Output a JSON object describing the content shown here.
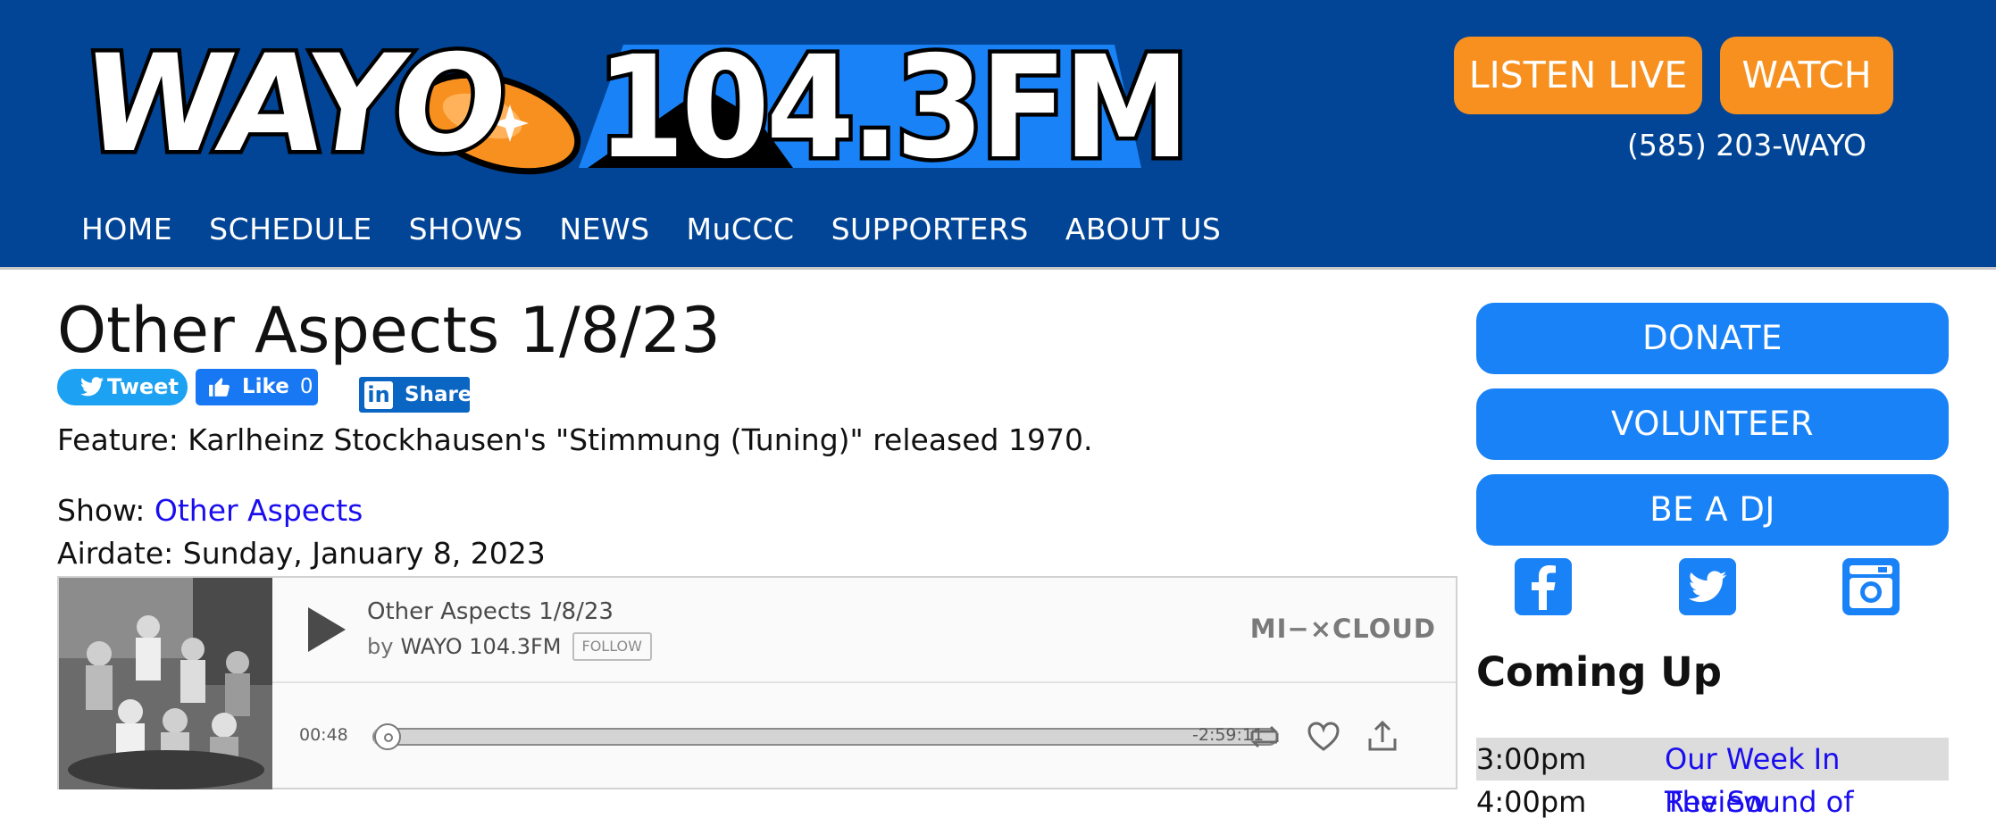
{
  "header": {
    "logo_text": "WAYO 104.3FM",
    "logo_wordmark": "WAYO",
    "logo_frequency": "104.3FM",
    "listen_live_label": "LISTEN LIVE",
    "watch_label": "WATCH",
    "phone": "(585) 203-WAYO",
    "nav": [
      "HOME",
      "SCHEDULE",
      "SHOWS",
      "NEWS",
      "MuCCC",
      "SUPPORTERS",
      "ABOUT US"
    ]
  },
  "post": {
    "title": "Other Aspects 1/8/23",
    "share": {
      "tweet_label": "Tweet",
      "like_label": "Like",
      "like_count": "0",
      "linkedin_label": "Share",
      "linkedin_icon_text": "in"
    },
    "feature": "Feature: Karlheinz Stockhausen's \"Stimmung (Tuning)\" released 1970.",
    "show_prefix": "Show: ",
    "show_name": "Other Aspects",
    "airdate": "Airdate: Sunday, January 8, 2023"
  },
  "player": {
    "track_title": "Other Aspects 1/8/23",
    "by_prefix": "by",
    "artist": "WAYO 104.3FM",
    "follow_label": "FOLLOW",
    "brand": "MI−×CLOUD",
    "time_elapsed": "00:48",
    "time_remaining": "-2:59:11",
    "progress_fraction": 0.004
  },
  "sidebar": {
    "donate_label": "DONATE",
    "volunteer_label": "VOLUNTEER",
    "dj_label": "BE A DJ",
    "social": [
      "facebook-icon",
      "twitter-icon",
      "instagram-icon"
    ],
    "coming_up_title": "Coming Up",
    "schedule": [
      {
        "time": "3:00pm",
        "show": "Our Week In Review"
      },
      {
        "time": "4:00pm",
        "show": "The Sound of"
      }
    ]
  },
  "colors": {
    "header_bg": "#024596",
    "orange_button": "#f7901e",
    "blue_button": "#1a82f7",
    "link": "#1a0dee"
  }
}
